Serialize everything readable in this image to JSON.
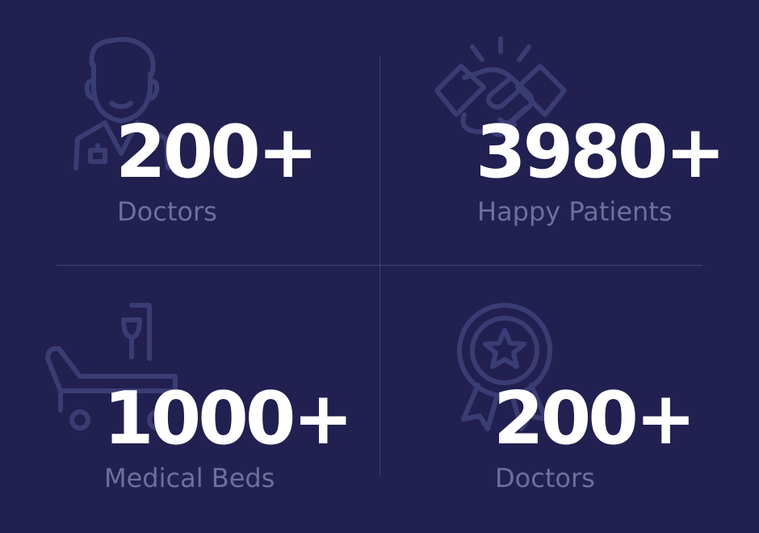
{
  "theme": {
    "background": "#222050",
    "number_color": "#ffffff",
    "label_color": "#6d6f9c",
    "icon_color": "#3a3d73"
  },
  "stats": [
    {
      "value": "200+",
      "label": "Doctors",
      "icon": "doctor-icon"
    },
    {
      "value": "3980+",
      "label": "Happy Patients",
      "icon": "handshake-icon"
    },
    {
      "value": "1000+",
      "label": "Medical Beds",
      "icon": "medical-bed-icon"
    },
    {
      "value": "200+",
      "label": "Doctors",
      "icon": "award-badge-icon"
    }
  ]
}
